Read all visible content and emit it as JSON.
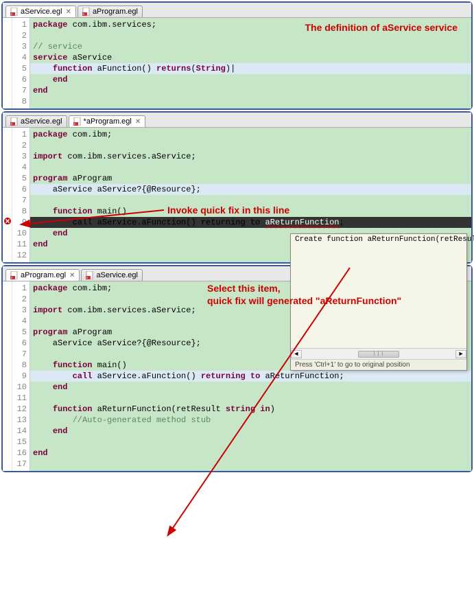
{
  "panels": [
    {
      "tabs": [
        {
          "label": "aService.egl",
          "active": true,
          "dirty": false
        },
        {
          "label": "aProgram.egl",
          "active": false,
          "dirty": false
        }
      ],
      "annotation": "The definition of aService service",
      "lines": [
        {
          "n": 1,
          "segs": [
            [
              "kw",
              "package"
            ],
            [
              "id",
              " com.ibm.services;"
            ]
          ]
        },
        {
          "n": 2,
          "segs": []
        },
        {
          "n": 3,
          "segs": [
            [
              "cm",
              "// service"
            ]
          ]
        },
        {
          "n": 4,
          "segs": [
            [
              "kw",
              "service"
            ],
            [
              "id",
              " aService"
            ]
          ],
          "fold": true
        },
        {
          "n": 5,
          "hl": true,
          "segs": [
            [
              "id",
              "    "
            ],
            [
              "kw",
              "function"
            ],
            [
              "id",
              " aFunction() "
            ],
            [
              "kw",
              "returns"
            ],
            [
              "id",
              "("
            ],
            [
              "str",
              "String"
            ],
            [
              "id",
              ")|"
            ]
          ]
        },
        {
          "n": 6,
          "segs": [
            [
              "id",
              "    "
            ],
            [
              "kw",
              "end"
            ]
          ]
        },
        {
          "n": 7,
          "segs": [
            [
              "kw",
              "end"
            ]
          ]
        },
        {
          "n": 8,
          "segs": []
        }
      ]
    },
    {
      "tabs": [
        {
          "label": "aService.egl",
          "active": false,
          "dirty": false
        },
        {
          "label": "*aProgram.egl",
          "active": true,
          "dirty": true
        }
      ],
      "annotation": "Invoke quick fix in this line",
      "popup": {
        "item": "Create function aReturnFunction(retResult",
        "hint": "Press 'Ctrl+1' to go to original position",
        "scroll_left": "◄",
        "scroll_right": "►"
      },
      "lines": [
        {
          "n": 1,
          "segs": [
            [
              "kw",
              "package"
            ],
            [
              "id",
              " com.ibm;"
            ]
          ]
        },
        {
          "n": 2,
          "segs": []
        },
        {
          "n": 3,
          "segs": [
            [
              "kw",
              "import"
            ],
            [
              "id",
              " com.ibm.services.aService;"
            ]
          ]
        },
        {
          "n": 4,
          "segs": []
        },
        {
          "n": 5,
          "segs": [
            [
              "kw",
              "program"
            ],
            [
              "id",
              " aProgram"
            ]
          ],
          "fold": true
        },
        {
          "n": 6,
          "hl": true,
          "segs": [
            [
              "id",
              "    aService aService?{@Resource};"
            ]
          ]
        },
        {
          "n": 7,
          "segs": []
        },
        {
          "n": 8,
          "segs": [
            [
              "id",
              "    "
            ],
            [
              "kw",
              "function"
            ],
            [
              "id",
              " main()"
            ]
          ],
          "fold": true
        },
        {
          "n": 9,
          "err": true,
          "inv": true,
          "segs": [
            [
              "id",
              "        call aService.aFunction() returning to "
            ],
            [
              "wavy",
              "aReturnFunction"
            ],
            [
              "id",
              ";"
            ]
          ]
        },
        {
          "n": 10,
          "segs": [
            [
              "id",
              "    "
            ],
            [
              "kw",
              "end"
            ]
          ]
        },
        {
          "n": 11,
          "segs": [
            [
              "kw",
              "end"
            ]
          ]
        },
        {
          "n": 12,
          "segs": []
        }
      ]
    },
    {
      "tabs": [
        {
          "label": "aProgram.egl",
          "active": true,
          "dirty": false
        },
        {
          "label": "aService.egl",
          "active": false,
          "dirty": false
        }
      ],
      "annotation1": "Select this item,",
      "annotation2": "quick fix will generated \"aReturnFunction\"",
      "lines": [
        {
          "n": 1,
          "segs": [
            [
              "kw",
              "package"
            ],
            [
              "id",
              " com.ibm;"
            ]
          ]
        },
        {
          "n": 2,
          "segs": []
        },
        {
          "n": 3,
          "segs": [
            [
              "kw",
              "import"
            ],
            [
              "id",
              " com.ibm.services.aService;"
            ]
          ]
        },
        {
          "n": 4,
          "segs": []
        },
        {
          "n": 5,
          "segs": [
            [
              "kw",
              "program"
            ],
            [
              "id",
              " aProgram"
            ]
          ],
          "fold": true
        },
        {
          "n": 6,
          "segs": [
            [
              "id",
              "    aService aService?{@Resource};"
            ]
          ]
        },
        {
          "n": 7,
          "segs": []
        },
        {
          "n": 8,
          "segs": [
            [
              "id",
              "    "
            ],
            [
              "kw",
              "function"
            ],
            [
              "id",
              " main()"
            ]
          ],
          "fold": true
        },
        {
          "n": 9,
          "hl": true,
          "segs": [
            [
              "id",
              "        "
            ],
            [
              "kw",
              "call"
            ],
            [
              "id",
              " aService.aFunction() "
            ],
            [
              "kw",
              "returning to"
            ],
            [
              "id",
              " aReturnFunction;"
            ]
          ]
        },
        {
          "n": 10,
          "segs": [
            [
              "id",
              "    "
            ],
            [
              "kw",
              "end"
            ]
          ]
        },
        {
          "n": 11,
          "segs": []
        },
        {
          "n": 12,
          "segs": [
            [
              "id",
              "    "
            ],
            [
              "kw",
              "function"
            ],
            [
              "id",
              " aReturnFunction(retResult "
            ],
            [
              "str",
              "string"
            ],
            [
              "id",
              " "
            ],
            [
              "kw",
              "in"
            ],
            [
              "id",
              ")"
            ]
          ],
          "fold": true
        },
        {
          "n": 13,
          "segs": [
            [
              "id",
              "        "
            ],
            [
              "cm",
              "//Auto-generated method stub"
            ]
          ]
        },
        {
          "n": 14,
          "segs": [
            [
              "id",
              "    "
            ],
            [
              "kw",
              "end"
            ]
          ]
        },
        {
          "n": 15,
          "segs": []
        },
        {
          "n": 16,
          "segs": [
            [
              "kw",
              "end"
            ]
          ]
        },
        {
          "n": 17,
          "segs": []
        }
      ]
    }
  ]
}
